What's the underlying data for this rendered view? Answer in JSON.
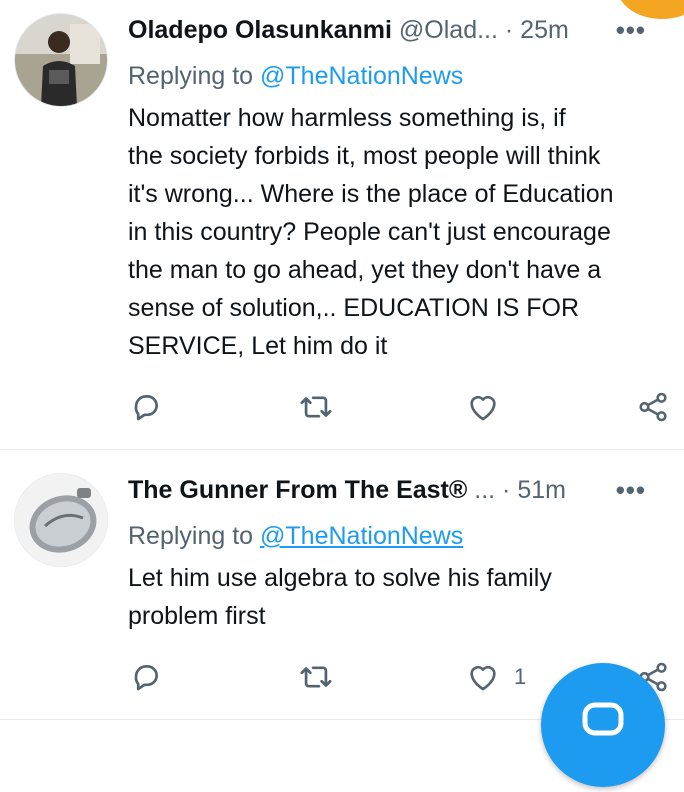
{
  "tweets": [
    {
      "display_name": "Oladepo Olasunkanmi",
      "handle": "@Olad...",
      "separator": "·",
      "time": "25m",
      "more": "•••",
      "reply_prefix": "Replying to",
      "reply_mention": "@TheNationNews",
      "text": "Nomatter how harmless something is, if\nthe society forbids it, most people will think\nit's wrong... Where is the place of Education\nin this country? People can't just encourage\nthe man to go ahead, yet they don't have a\nsense of solution,.. EDUCATION IS FOR\nSERVICE, Let him do it",
      "like_count": ""
    },
    {
      "display_name": "The Gunner From The East®",
      "handle": "...",
      "separator": "·",
      "time": "51m",
      "more": "•••",
      "reply_prefix": "Replying to",
      "reply_mention": "@TheNationNews",
      "text": "Let him use algebra to solve his family\nproblem first",
      "like_count": "1"
    }
  ],
  "icons": {
    "reply": "reply-icon",
    "retweet": "retweet-icon",
    "like": "heart-icon",
    "share": "share-icon",
    "compose": "compose-fab"
  },
  "colors": {
    "accent": "#1d9bf0",
    "secondary_text": "#536471",
    "divider": "#e6ecf0"
  }
}
